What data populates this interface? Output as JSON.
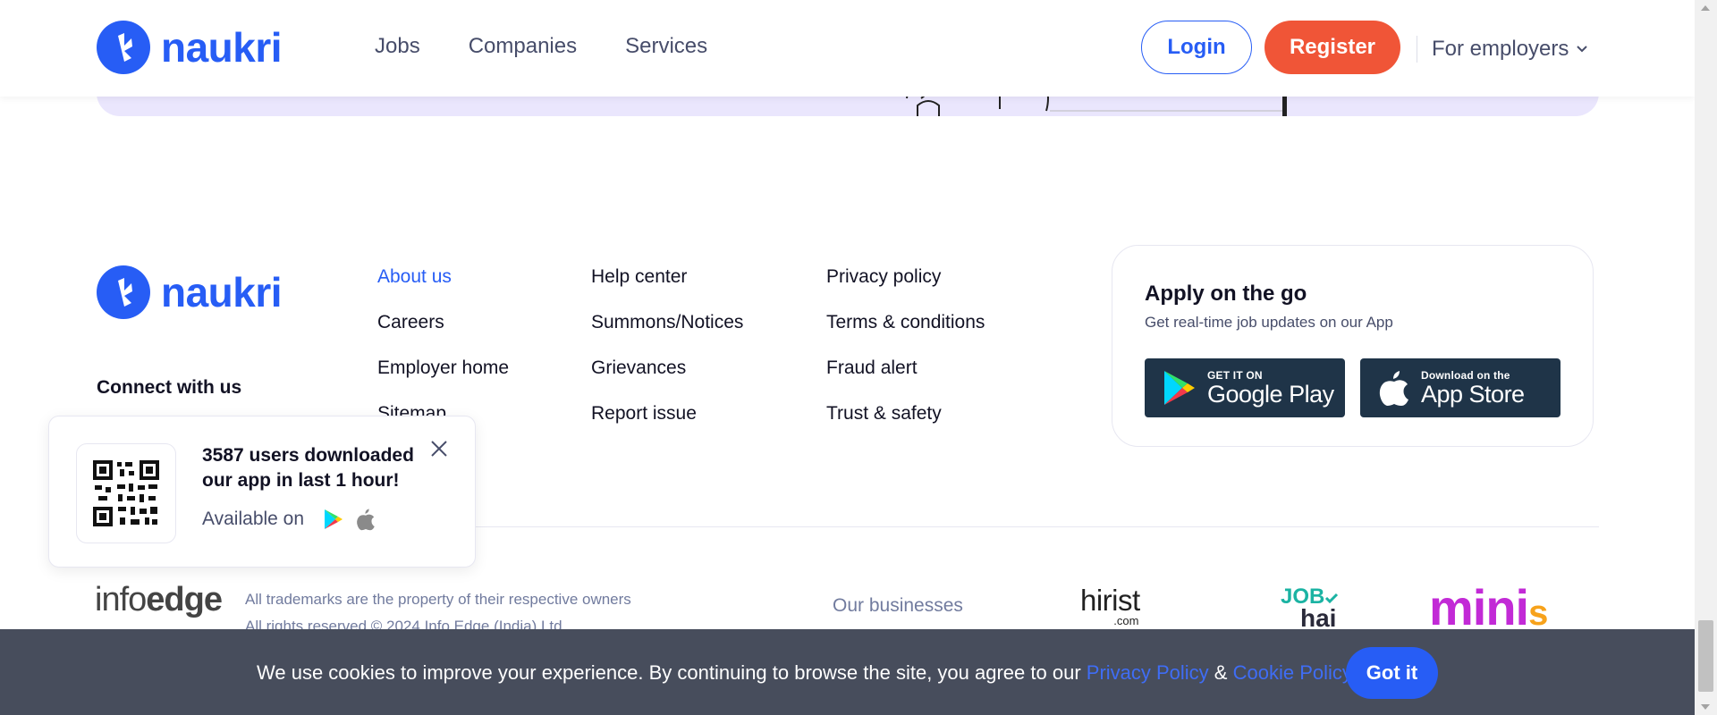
{
  "brand": {
    "name": "naukri",
    "color": "#275df5"
  },
  "header": {
    "nav": [
      "Jobs",
      "Companies",
      "Services"
    ],
    "login_label": "Login",
    "register_label": "Register",
    "employers_label": "For employers"
  },
  "footer": {
    "connect_label": "Connect with us",
    "col1": [
      "About us",
      "Careers",
      "Employer home",
      "Sitemap"
    ],
    "col2": [
      "Help center",
      "Summons/Notices",
      "Grievances",
      "Report issue"
    ],
    "col3": [
      "Privacy policy",
      "Terms & conditions",
      "Fraud alert",
      "Trust & safety"
    ],
    "app": {
      "title": "Apply on the go",
      "subtitle": "Get real-time job updates on our App",
      "google_small": "GET IT ON",
      "google_big": "Google Play",
      "apple_small": "Download on the",
      "apple_big": "App Store"
    },
    "infoedge": {
      "prefix": "info",
      "suffix": "edge"
    },
    "trademark_line1": "All trademarks are the property of their respective owners",
    "trademark_line2": "All rights reserved © 2024 Info Edge (India) Ltd.",
    "our_businesses": "Our businesses",
    "businesses": {
      "hirist": "hirist",
      "hirist_tld": ".com",
      "jobhai_top": "JOB",
      "jobhai_bottom": "hai",
      "minis_main": "mini",
      "minis_s": "s"
    }
  },
  "popup": {
    "line1": "3587 users downloaded",
    "line2": "our app in last 1 hour!",
    "available_on": "Available on"
  },
  "cookie": {
    "text": "We use cookies to improve your experience. By continuing to browse the site, you agree to our ",
    "privacy_link": "Privacy Policy",
    "ampersand": " & ",
    "cookie_link": "Cookie Policy",
    "button": "Got it"
  }
}
